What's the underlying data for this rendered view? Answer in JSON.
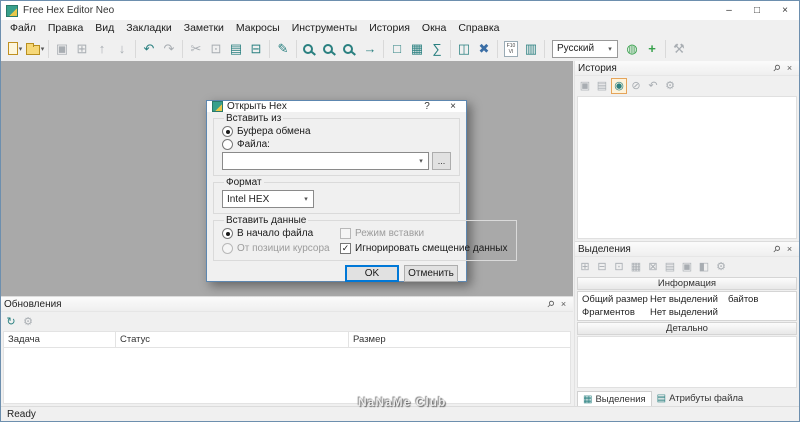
{
  "window": {
    "title": "Free Hex Editor Neo",
    "status": "Ready",
    "watermark": "NaNaMe Club"
  },
  "glyphs": {
    "minimize": "–",
    "maximize": "□",
    "close": "×",
    "pin": "⚲",
    "caret": "▾",
    "help": "?",
    "check": "✓",
    "dots": "..."
  },
  "menu": {
    "items": [
      "Файл",
      "Правка",
      "Вид",
      "Закладки",
      "Заметки",
      "Макросы",
      "Инструменты",
      "История",
      "Окна",
      "Справка"
    ]
  },
  "toolbar": {
    "language": "Русский",
    "icons": {
      "save": "▣",
      "save_all": "⊞",
      "export": "↑",
      "import": "↓",
      "undo": "↶",
      "redo": "↷",
      "cut": "✂",
      "copy": "⊡",
      "paste": "▤",
      "print": "⊟",
      "edit": "✎",
      "goto": "→",
      "select": "□",
      "fill": "▦",
      "checksum": "∑",
      "panels": "◫",
      "close_all": "✖",
      "viewer_top": "F10",
      "viewer_bottom": "VI",
      "box": "▥",
      "globe": "◍",
      "add": "+",
      "tools": "⚒"
    }
  },
  "panels": {
    "history": {
      "title": "История",
      "icons": {
        "save": "▣",
        "load": "▤",
        "branches": "◉",
        "clear": "⊘",
        "back": "↶",
        "settings": "⚙"
      }
    },
    "selections": {
      "title": "Выделения",
      "icons": {
        "add": "⊞",
        "remove": "⊟",
        "invert": "⊡",
        "all": "▦",
        "clear": "⊠",
        "load": "▤",
        "save": "▣",
        "union": "◧",
        "settings": "⚙"
      },
      "info_header": "Информация",
      "rows": [
        {
          "label": "Общий размер",
          "value": "Нет выделений",
          "unit": "байтов"
        },
        {
          "label": "Фрагментов",
          "value": "Нет выделений",
          "unit": ""
        }
      ],
      "details_label": "Детально",
      "tabs": [
        {
          "label": "Выделения"
        },
        {
          "label": "Атрибуты файла"
        }
      ]
    },
    "updates": {
      "title": "Обновления",
      "icons": {
        "check": "↻",
        "settings": "⚙"
      },
      "columns": [
        "Задача",
        "Статус",
        "Размер"
      ]
    }
  },
  "dialog": {
    "title": "Открыть Hex",
    "insert_from": {
      "legend": "Вставить из",
      "clipboard": "Буфера обмена",
      "file": "Файла:"
    },
    "format": {
      "legend": "Формат",
      "value": "Intel HEX"
    },
    "insert_data": {
      "legend": "Вставить данные",
      "to_begin": "В начало файла",
      "from_cursor": "От позиции курсора",
      "insert_mode": "Режим вставки",
      "ignore_offset": "Игнорировать смещение данных"
    },
    "buttons": {
      "ok": "OK",
      "cancel": "Отменить"
    }
  }
}
